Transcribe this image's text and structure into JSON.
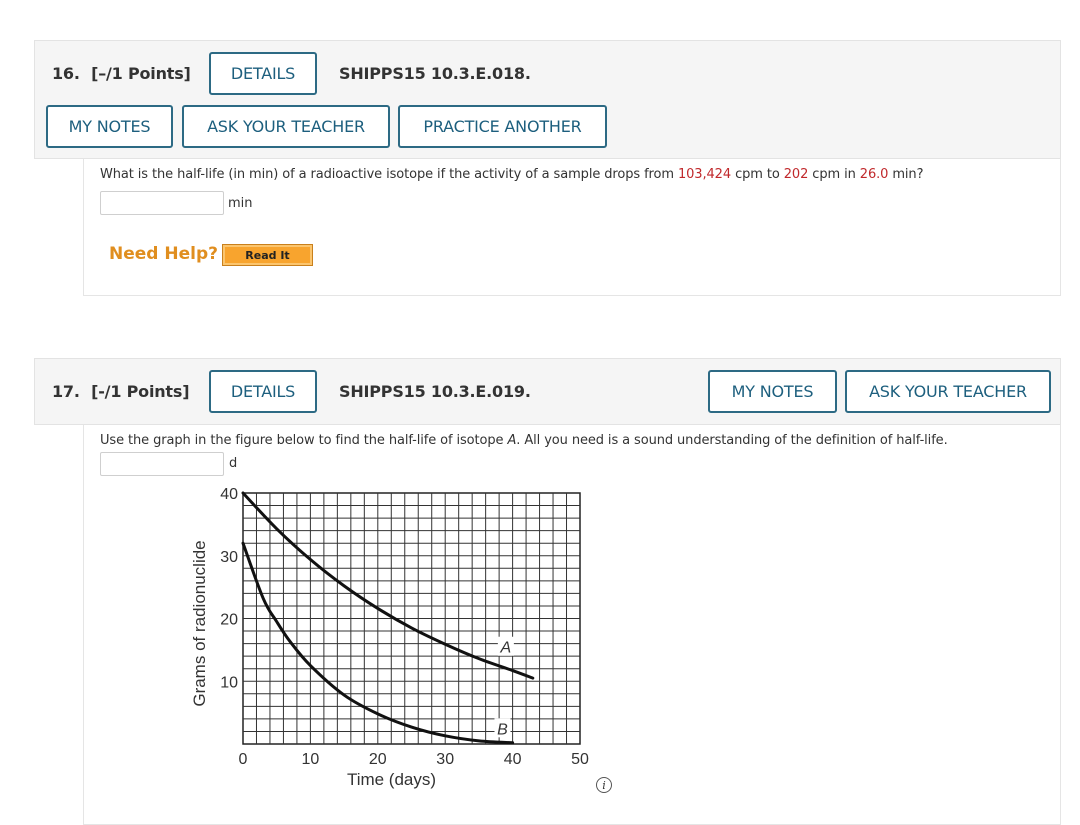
{
  "questions": [
    {
      "number_label": "16.",
      "points_label": "[–/1 Points]",
      "details_label": "DETAILS",
      "code": "SHIPPS15 10.3.E.018.",
      "buttons": {
        "my_notes": "MY NOTES",
        "ask_teacher": "ASK YOUR TEACHER",
        "practice_another": "PRACTICE ANOTHER"
      },
      "text_parts": [
        {
          "text": "What is the half-life (in min) of a radioactive isotope if the activity of a sample drops from ",
          "highlight": false
        },
        {
          "text": "103,424",
          "highlight": true
        },
        {
          "text": " cpm to ",
          "highlight": false
        },
        {
          "text": "202",
          "highlight": true
        },
        {
          "text": " cpm in ",
          "highlight": false
        },
        {
          "text": "26.0",
          "highlight": true
        },
        {
          "text": " min?",
          "highlight": false
        }
      ],
      "answer_value": "",
      "unit": "min",
      "need_help_label": "Need Help?",
      "read_it_label": "Read It"
    },
    {
      "number_label": "17.",
      "points_label": "[-/1 Points]",
      "details_label": "DETAILS",
      "code": "SHIPPS15 10.3.E.019.",
      "buttons": {
        "my_notes": "MY NOTES",
        "ask_teacher": "ASK YOUR TEACHER"
      },
      "text_before": "Use the graph in the figure below to find the half-life of isotope ",
      "text_italic": "A",
      "text_after": ". All you need is a sound understanding of the definition of half-life.",
      "answer_value": "",
      "unit": "d",
      "info_icon": "info-icon",
      "info_glyph": "i"
    }
  ],
  "highlight_color": "#c0282b",
  "chart_data": {
    "type": "line",
    "title": "",
    "xlabel": "Time (days)",
    "ylabel": "Grams of radionuclide",
    "xlim": [
      0,
      50
    ],
    "ylim": [
      0,
      40
    ],
    "x_ticks": [
      0,
      10,
      20,
      30,
      40,
      50
    ],
    "y_ticks": [
      10,
      20,
      30,
      40
    ],
    "x_tick_labels": [
      "0",
      "10",
      "20",
      "30",
      "40",
      "50"
    ],
    "y_tick_labels": [
      "10",
      "20",
      "30",
      "40"
    ],
    "grid": true,
    "grid_step_x": 2,
    "grid_step_y": 2,
    "series": [
      {
        "name": "A",
        "x": [
          0,
          5,
          10,
          15,
          20,
          25,
          30,
          35,
          40,
          43
        ],
        "y": [
          40,
          34.3,
          29.4,
          25.2,
          21.6,
          18.5,
          15.9,
          13.6,
          11.7,
          10.5
        ]
      },
      {
        "name": "B",
        "x": [
          0,
          3,
          5,
          7,
          10,
          15,
          20,
          25,
          30,
          35,
          40
        ],
        "y": [
          32,
          23.2,
          19.5,
          16.3,
          12.5,
          7.8,
          4.8,
          2.7,
          1.3,
          0.5,
          0.2
        ]
      }
    ],
    "annotations": [
      {
        "text": "A",
        "x": 39,
        "y": 15.5
      },
      {
        "text": "B",
        "x": 38.5,
        "y": 2.5
      }
    ]
  }
}
